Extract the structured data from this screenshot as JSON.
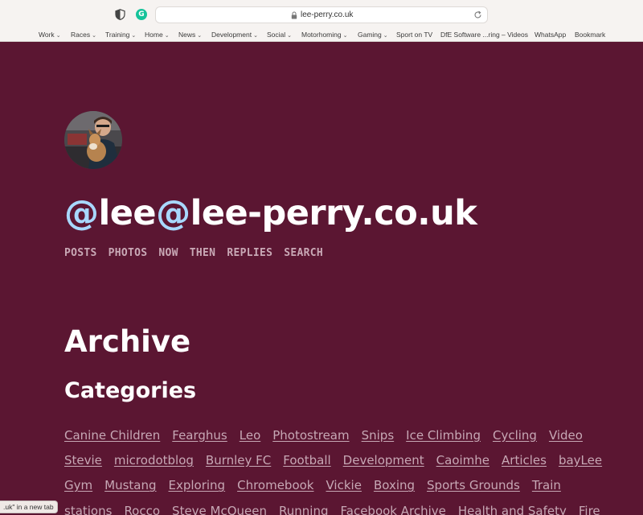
{
  "browser": {
    "url": "lee-perry.co.uk",
    "bookmarks": [
      {
        "label": "Work",
        "dropdown": true
      },
      {
        "label": "Races",
        "dropdown": true
      },
      {
        "label": "Training",
        "dropdown": true
      },
      {
        "label": "Home",
        "dropdown": true
      },
      {
        "label": "News",
        "dropdown": true
      },
      {
        "label": "Development",
        "dropdown": true
      },
      {
        "label": "Social",
        "dropdown": true
      },
      {
        "label": "Motorhoming",
        "dropdown": true
      },
      {
        "label": "Gaming",
        "dropdown": true
      },
      {
        "label": "Sport on TV",
        "dropdown": false
      },
      {
        "label": "DfE Software ...ring – Videos",
        "dropdown": false
      },
      {
        "label": "WhatsApp",
        "dropdown": false
      },
      {
        "label": "Bookmark",
        "dropdown": false
      }
    ],
    "status_text": ".uk\" in a new tab"
  },
  "site": {
    "title_at1": "@",
    "title_part1": "lee",
    "title_at2": "@",
    "title_part2": "lee-perry.co.uk",
    "nav": [
      "POSTS",
      "PHOTOS",
      "NOW",
      "THEN",
      "REPLIES",
      "SEARCH"
    ]
  },
  "page": {
    "heading": "Archive",
    "categories_heading": "Categories",
    "category_rows": [
      [
        "Canine Children",
        "Fearghus",
        "Leo",
        "Photostream",
        "Snips",
        "Ice Climbing",
        "Cycling",
        "Video"
      ],
      [
        "Stevie",
        "microdotblog",
        "Burnley FC",
        "Football",
        "Development",
        "Caoimhe",
        "Articles",
        "bayLee"
      ],
      [
        "Gym",
        "Mustang",
        "Exploring",
        "Chromebook",
        "Vickie",
        "Boxing",
        "Sports Grounds",
        "Train"
      ],
      [
        "stations",
        "Rocco",
        "Steve McQueen",
        "Running",
        "Facebook Archive",
        "Health and Safety",
        "Fire"
      ]
    ]
  },
  "colors": {
    "background": "#5b1632",
    "title_at": "#a8d8ff",
    "link": "#c7a8b5",
    "nav": "#c9a9b6"
  }
}
